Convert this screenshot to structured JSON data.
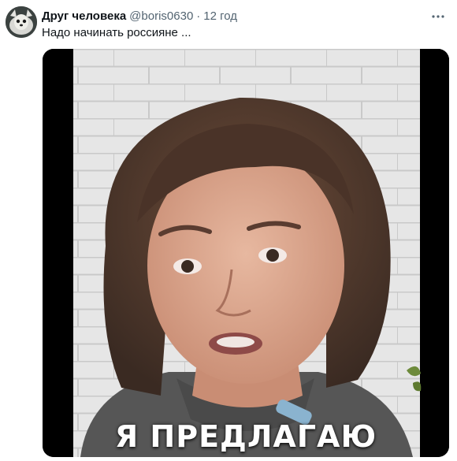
{
  "tweet": {
    "display_name": "Друг человека",
    "handle": "@boris0630",
    "separator": "·",
    "time": "12 год",
    "text": "Надо начинать россияне ...",
    "more_icon": "more-horizontal-icon"
  },
  "media": {
    "caption": "Я ПРЕДЛАГАЮ",
    "caption_color": "#ffffff",
    "background": "#000000"
  }
}
